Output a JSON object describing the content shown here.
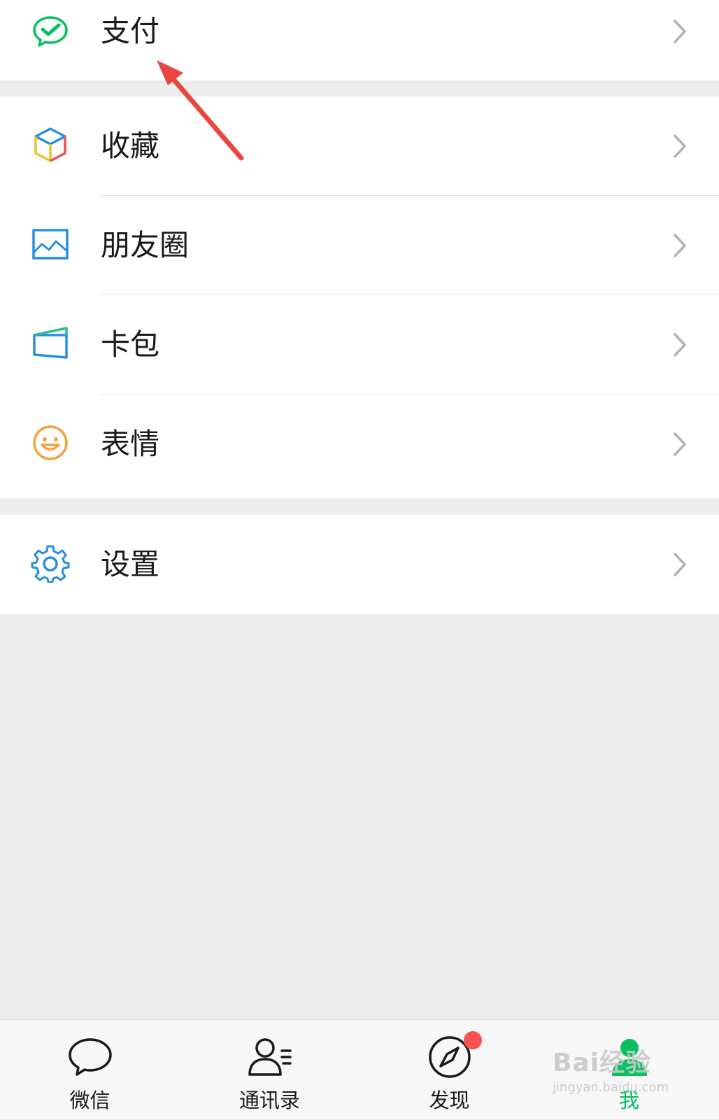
{
  "menu": {
    "pay": {
      "label": "支付",
      "icon": "wechat-pay-icon",
      "color": "#07c160"
    },
    "items": [
      {
        "label": "收藏",
        "icon": "favorites-cube-icon"
      },
      {
        "label": "朋友圈",
        "icon": "moments-image-icon",
        "color": "#2b8de0"
      },
      {
        "label": "卡包",
        "icon": "card-wallet-icon",
        "color": "#2b8de0"
      },
      {
        "label": "表情",
        "icon": "emoji-smile-icon",
        "color": "#f5a041"
      }
    ],
    "settings": {
      "label": "设置",
      "icon": "settings-gear-icon",
      "color": "#2b8de0"
    }
  },
  "tabbar": {
    "tabs": [
      {
        "label": "微信",
        "icon": "chat-bubble-icon",
        "active": false
      },
      {
        "label": "通讯录",
        "icon": "contacts-icon",
        "active": false
      },
      {
        "label": "发现",
        "icon": "compass-icon",
        "active": false,
        "badge": true
      },
      {
        "label": "我",
        "icon": "me-person-icon",
        "active": true
      }
    ],
    "active_color": "#07c160",
    "badge_color": "#fa5151"
  },
  "annotation": {
    "arrow_color": "#e8473f"
  },
  "watermark": {
    "brand": "Bai经验",
    "url": "jingyan.baidu.com"
  }
}
